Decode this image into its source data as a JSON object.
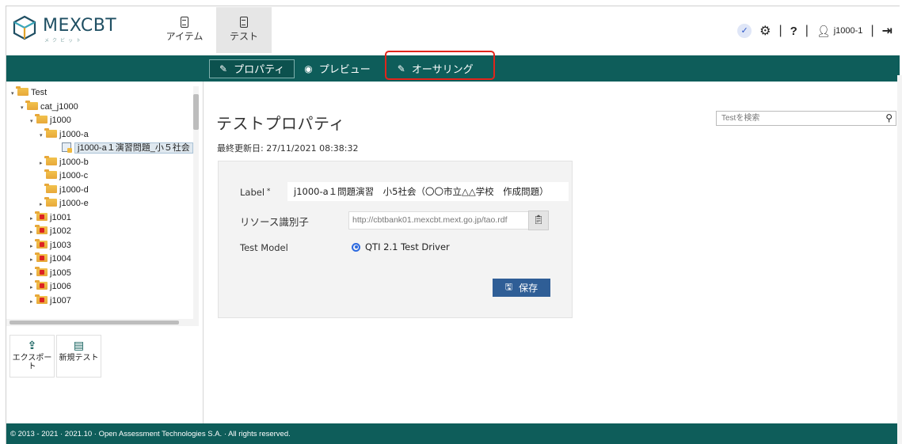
{
  "brand": {
    "name": "MEXCBT",
    "sub": "メクビット"
  },
  "nav": {
    "items_label": "アイテム",
    "tests_label": "テスト"
  },
  "header_right": {
    "username": "j1000-1"
  },
  "actions": {
    "properties": "プロパティ",
    "preview": "プレビュー",
    "authoring": "オーサリング"
  },
  "search": {
    "placeholder": "Testを検索"
  },
  "tree": [
    {
      "label": "Test",
      "indent": 0,
      "arrow": "▾",
      "icon": "folder-open"
    },
    {
      "label": "cat_j1000",
      "indent": 1,
      "arrow": "▾",
      "icon": "folder-open"
    },
    {
      "label": "j1000",
      "indent": 2,
      "arrow": "▾",
      "icon": "folder-open"
    },
    {
      "label": "j1000-a",
      "indent": 3,
      "arrow": "▾",
      "icon": "folder-open"
    },
    {
      "label": "j1000-a１演習問題_小５社会",
      "indent": 4,
      "arrow": "",
      "icon": "test",
      "selected": true
    },
    {
      "label": "j1000-b",
      "indent": 3,
      "arrow": "▸",
      "icon": "folder"
    },
    {
      "label": "j1000-c",
      "indent": 3,
      "arrow": "",
      "icon": "folder"
    },
    {
      "label": "j1000-d",
      "indent": 3,
      "arrow": "",
      "icon": "folder"
    },
    {
      "label": "j1000-e",
      "indent": 3,
      "arrow": "▸",
      "icon": "folder"
    },
    {
      "label": "j1001",
      "indent": 2,
      "arrow": "▸",
      "icon": "folder-locked"
    },
    {
      "label": "j1002",
      "indent": 2,
      "arrow": "▸",
      "icon": "folder-locked"
    },
    {
      "label": "j1003",
      "indent": 2,
      "arrow": "▸",
      "icon": "folder-locked"
    },
    {
      "label": "j1004",
      "indent": 2,
      "arrow": "▸",
      "icon": "folder-locked"
    },
    {
      "label": "j1005",
      "indent": 2,
      "arrow": "▸",
      "icon": "folder-locked"
    },
    {
      "label": "j1006",
      "indent": 2,
      "arrow": "▸",
      "icon": "folder-locked"
    },
    {
      "label": "j1007",
      "indent": 2,
      "arrow": "▸",
      "icon": "folder-locked"
    }
  ],
  "tools": {
    "export": "エクスポート",
    "new_test": "新規テスト"
  },
  "main": {
    "title": "テストプロパティ",
    "last_updated": "最終更新日: 27/11/2021 08:38:32",
    "form": {
      "label_label": "Label",
      "label_value": "j1000-a１問題演習　小5社会（〇〇市立△△学校　作成問題）",
      "uri_label": "リソース識別子",
      "uri_value": "http://cbtbank01.mexcbt.mext.go.jp/tao.rdf",
      "model_label": "Test Model",
      "model_value": "QTI 2.1 Test Driver",
      "save_label": "保存"
    }
  },
  "footer": {
    "text": "© 2013 - 2021 · 2021.10 · Open Assessment Technologies S.A. · All rights reserved."
  },
  "colors": {
    "accent": "#0e5d5a",
    "save": "#2f5e96",
    "highlight": "#e1251b"
  }
}
